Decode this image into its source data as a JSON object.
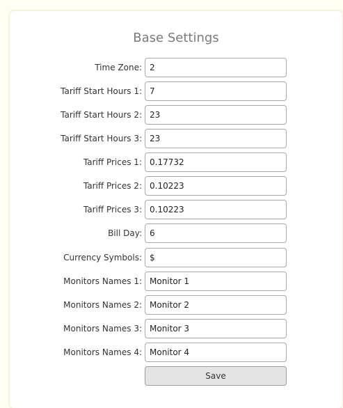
{
  "form": {
    "title": "Base Settings",
    "fields": [
      {
        "label": "Time Zone:",
        "value": "2"
      },
      {
        "label": "Tariff Start Hours 1:",
        "value": "7"
      },
      {
        "label": "Tariff Start Hours 2:",
        "value": "23"
      },
      {
        "label": "Tariff Start Hours 3:",
        "value": "23"
      },
      {
        "label": "Tariff Prices 1:",
        "value": "0.17732"
      },
      {
        "label": "Tariff Prices 2:",
        "value": "0.10223"
      },
      {
        "label": "Tariff Prices 3:",
        "value": "0.10223"
      },
      {
        "label": "Bill Day:",
        "value": "6"
      },
      {
        "label": "Currency Symbols:",
        "value": "$"
      },
      {
        "label": "Monitors Names 1:",
        "value": "Monitor 1"
      },
      {
        "label": "Monitors Names 2:",
        "value": "Monitor 2"
      },
      {
        "label": "Monitors Names 3:",
        "value": "Monitor 3"
      },
      {
        "label": "Monitors Names 4:",
        "value": "Monitor 4"
      }
    ],
    "save_label": "Save"
  },
  "colors": {
    "page_background": "#fefef3",
    "card_background": "#ffffff",
    "button_background": "#e4e4e4"
  }
}
